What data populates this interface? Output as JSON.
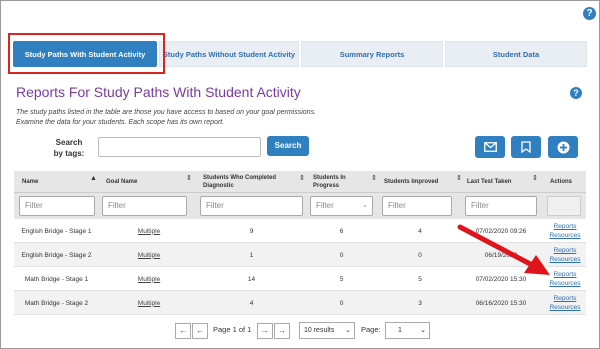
{
  "help_glyph": "?",
  "tabs": [
    {
      "label": "Study Paths With Student Activity",
      "active": true
    },
    {
      "label": "Study Paths Without Student Activity",
      "active": false
    },
    {
      "label": "Summary Reports",
      "active": false
    },
    {
      "label": "Student Data",
      "active": false
    }
  ],
  "page_title": "Reports For Study Paths With Student Activity",
  "description": [
    "The study paths listed in the table are those you have access to based on your goal permissions.",
    "Examine the data for your students. Each scope has its own report."
  ],
  "search": {
    "label_line1": "Search",
    "label_line2": "by tags:",
    "value": "",
    "button_label": "Search"
  },
  "toolbar_icons": [
    "envelope-icon",
    "bookmark-icon",
    "plus-icon"
  ],
  "table": {
    "headers": [
      "Name",
      "Goal Name",
      "Students Who Completed Diagnostic",
      "Students In Progress",
      "Students Improved",
      "Last Test Taken",
      "Actions"
    ],
    "filter_placeholder": "Filter",
    "rows": [
      {
        "name": "English Bridge - Stage 1",
        "goal": "Multiple",
        "completed": "9",
        "in_progress": "6",
        "improved": "4",
        "last_test": "07/02/2020 09:26",
        "action1": "Reports",
        "action2": "Resources"
      },
      {
        "name": "English Bridge - Stage 2",
        "goal": "Multiple",
        "completed": "1",
        "in_progress": "0",
        "improved": "0",
        "last_test": "06/19/2020",
        "action1": "Reports",
        "action2": "Resources"
      },
      {
        "name": "Math Bridge - Stage 1",
        "goal": "Multiple",
        "completed": "14",
        "in_progress": "5",
        "improved": "5",
        "last_test": "07/02/2020 15:30",
        "action1": "Reports",
        "action2": "Resources"
      },
      {
        "name": "Math Bridge - Stage 2",
        "goal": "Multiple",
        "completed": "4",
        "in_progress": "0",
        "improved": "3",
        "last_test": "06/16/2020 15:30",
        "action1": "Reports",
        "action2": "Resources"
      }
    ]
  },
  "pagination": {
    "first": "←",
    "prev": "←",
    "page_info": "Page 1 of 1",
    "next": "→",
    "last": "→",
    "results_select": "10 results",
    "page_label": "Page:",
    "page_select": "1"
  },
  "colors": {
    "accent": "#2f7fc1",
    "title": "#7a3aa0",
    "highlight": "#d9251d",
    "arrow": "#e0121a"
  }
}
